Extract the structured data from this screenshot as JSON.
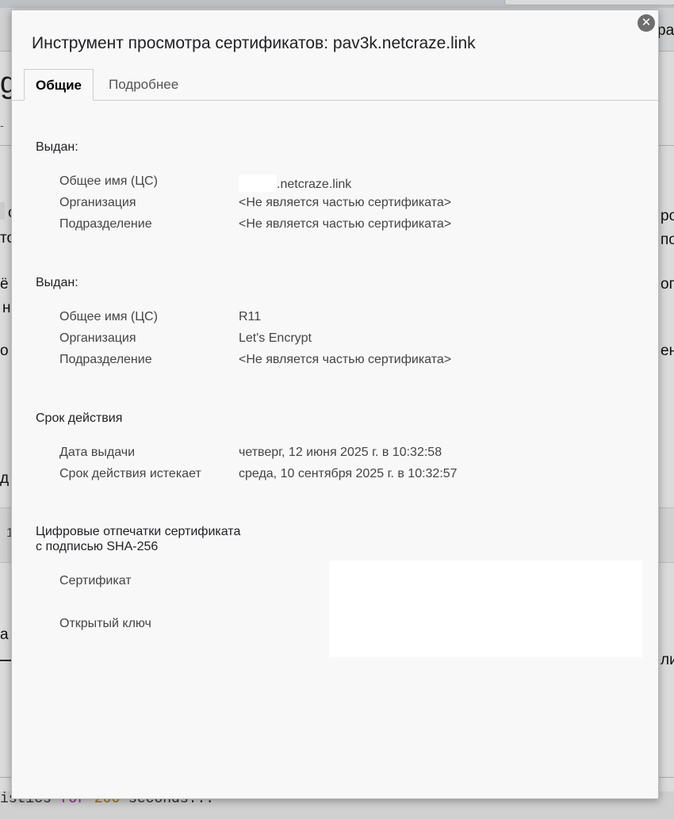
{
  "dialog": {
    "title": "Инструмент просмотра сертификатов: pav3k.netcraze.link",
    "tabs": [
      "Общие",
      "Подробнее"
    ],
    "issued_to": {
      "heading": "Выдан:",
      "rows": [
        {
          "label": "Общее имя (ЦС)",
          "value": ".netcraze.link"
        },
        {
          "label": "Организация",
          "value": "<Не является частью сертификата>"
        },
        {
          "label": "Подразделение",
          "value": "<Не является частью сертификата>"
        }
      ]
    },
    "issued_by": {
      "heading": "Выдан:",
      "rows": [
        {
          "label": "Общее имя (ЦС)",
          "value": "R11"
        },
        {
          "label": "Организация",
          "value": "Let's Encrypt"
        },
        {
          "label": "Подразделение",
          "value": "<Не является частью сертификата>"
        }
      ]
    },
    "validity": {
      "heading": "Срок действия",
      "rows": [
        {
          "label": "Дата выдачи",
          "value": "четверг, 12 июня 2025 г. в 10:32:58"
        },
        {
          "label": "Срок действия истекает",
          "value": "среда, 10 сентября 2025 г. в 10:32:57"
        }
      ]
    },
    "fingerprints": {
      "heading_line1": "Цифровые отпечатки сертификата",
      "heading_line2": "с подписью SHA-256",
      "rows": [
        {
          "label": "Сертификат"
        },
        {
          "label": "Открытый ключ"
        }
      ]
    }
  },
  "background": {
    "frag_title": "g",
    "frag_right_top": "ра",
    "frag_l1": "с",
    "frag_l2": "то",
    "frag_l3": "ё",
    "frag_l4": "н",
    "frag_l5": "о",
    "frag_l6": "д",
    "frag_l7": "1",
    "frag_l8": "а",
    "frag_r1": "ро",
    "frag_r2": "по",
    "frag_r3": "оп",
    "frag_r4": "ен",
    "frag_r5": "ли",
    "code_pre": "istics ",
    "code_kw": "for",
    "code_num": "200",
    "code_post": " seconds..."
  }
}
